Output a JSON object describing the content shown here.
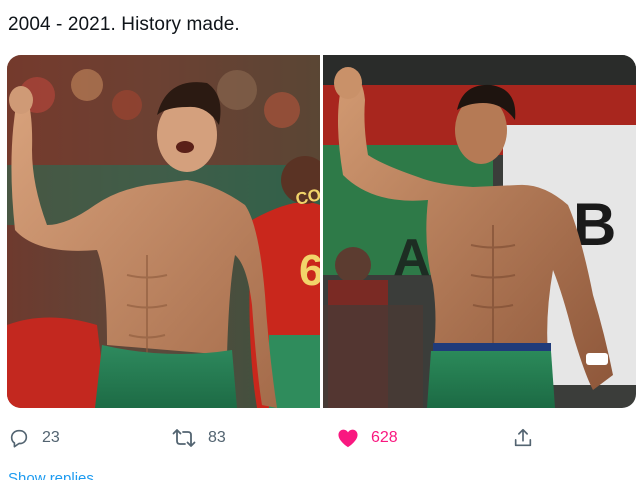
{
  "tweet": {
    "text": "2004 - 2021. History made."
  },
  "media": {
    "left_photo": {
      "jersey_name": "COSTA",
      "jersey_number": "6"
    },
    "right_photo": {
      "banner_letter": "B",
      "banner_letter_2": "A"
    }
  },
  "actions": {
    "reply_count": "23",
    "retweet_count": "83",
    "like_count": "628",
    "like_active": true
  },
  "footer": {
    "show_thread_label": "Show replies"
  },
  "colors": {
    "text": "#0f1419",
    "muted": "#536471",
    "like": "#f91880",
    "link": "#1d9bf0"
  },
  "icons": [
    "reply-icon",
    "retweet-icon",
    "heart-icon",
    "share-icon"
  ]
}
